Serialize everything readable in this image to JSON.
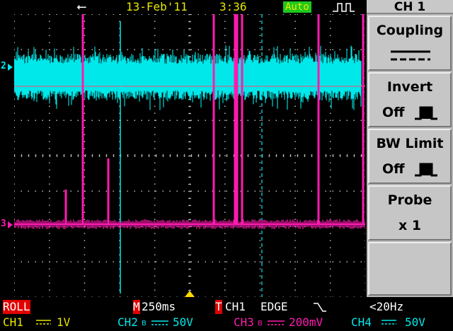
{
  "status_bar": {
    "date": "13-Feb'11",
    "time": "3:36",
    "trigger_mode": "Auto"
  },
  "screen": {
    "channel_markers": {
      "ch2": "2",
      "ch3": "3"
    },
    "colors": {
      "ch2": "#00e8ea",
      "ch3": "#ff1ab0",
      "grid": "#b8b8b8",
      "trigger_marker": "#ffd800"
    }
  },
  "menu": {
    "title": "CH 1",
    "items": [
      {
        "label": "Coupling",
        "value": ""
      },
      {
        "label": "Invert",
        "value": "Off"
      },
      {
        "label": "BW Limit",
        "value": "Off"
      },
      {
        "label": "Probe",
        "value": "x 1"
      }
    ]
  },
  "bottom": {
    "mode": "ROLL",
    "timebase_tag": "M",
    "timebase": "250ms",
    "trigger_tag": "T",
    "trigger_source": "CH1",
    "trigger_type": "EDGE",
    "trigger_freq": "<20Hz",
    "ch1_label": "CH1",
    "ch1_scale": "1V",
    "ch2_label": "CH2",
    "ch2_scale": "50V",
    "ch3_label": "CH3",
    "ch3_scale": "200mV",
    "ch4_label": "CH4",
    "ch4_scale": "50V"
  }
}
